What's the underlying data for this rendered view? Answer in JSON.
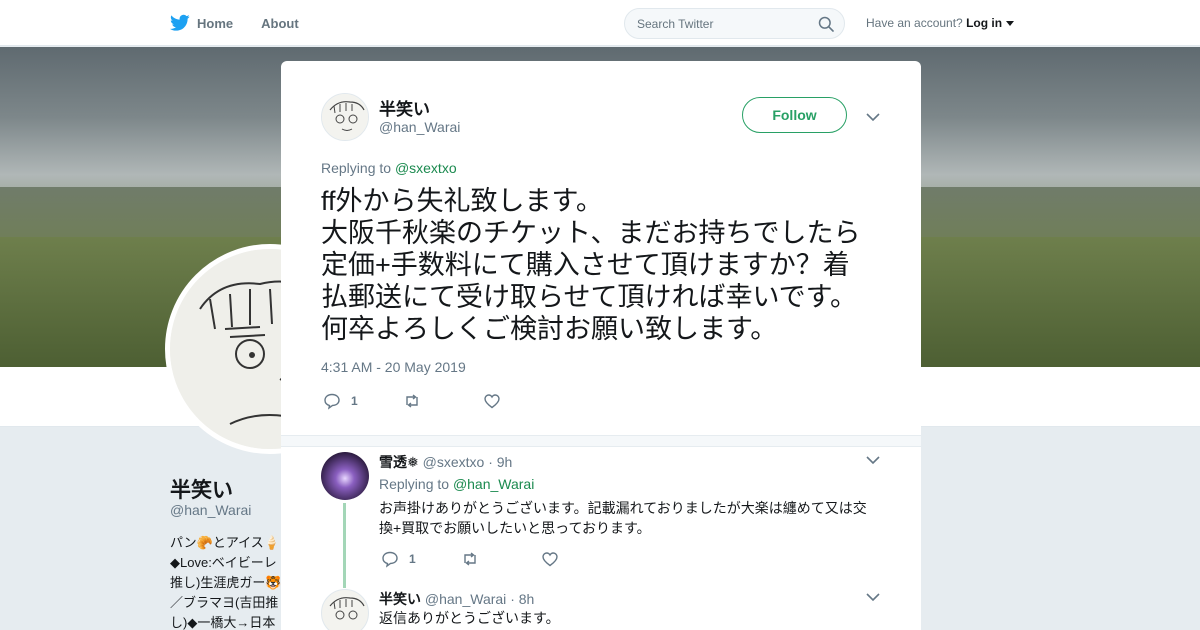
{
  "nav": {
    "home_label": "Home",
    "about_label": "About",
    "search_placeholder": "Search Twitter",
    "account_prompt": "Have an account?",
    "login_label": "Log in"
  },
  "colors": {
    "brand_blue": "#1da1f2",
    "accent_green": "#28a065",
    "link_green": "#1b8a4f",
    "thread_line": "#a3d6b7"
  },
  "profile": {
    "name": "半笑い",
    "handle": "@han_Warai",
    "bio_lines": [
      "パン🥐とアイス🍦",
      "◆Love:ベイビーレ",
      "推し)生涯虎ガー🐯",
      "／ブラマヨ(吉田推",
      "し)◆一橋大→日本"
    ]
  },
  "tweet": {
    "author_name": "半笑い",
    "author_handle": "@han_Warai",
    "follow_label": "Follow",
    "replying_prefix": "Replying to",
    "replying_to": "@sxextxo",
    "text_lines": [
      "ff外から失礼致します。",
      "大阪千秋楽のチケット、まだお持ちでしたら",
      "定価+手数料にて購入させて頂けますか？着",
      "払郵送にて受け取らせて頂ければ幸いです。",
      "何卒よろしくご検討お願い致します。"
    ],
    "timestamp": "4:31 AM - 20 May 2019",
    "reply_count": "1",
    "retweet_count": "",
    "like_count": ""
  },
  "replies": [
    {
      "author_name": "雪透❅",
      "author_handle": "@sxextxo",
      "age": "9h",
      "replying_prefix": "Replying to",
      "replying_to": "@han_Warai",
      "text_lines": [
        "お声掛けありがとうございます。記載漏れておりましたが大楽は纏めて又は交",
        "換+買取でお願いしたいと思っております。"
      ],
      "reply_count": "1",
      "retweet_count": "",
      "like_count": ""
    },
    {
      "author_name": "半笑い",
      "author_handle": "@han_Warai",
      "age": "8h",
      "text_lines": [
        "返信ありがとうございます。"
      ]
    }
  ]
}
